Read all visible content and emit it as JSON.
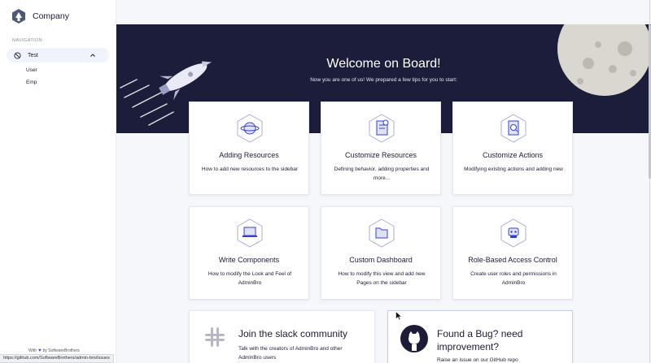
{
  "brand": {
    "name": "Company",
    "logo_icon": "company-logo-icon"
  },
  "sidebar": {
    "heading": "NAVIGATION",
    "group": {
      "label": "Test",
      "icon": "compass-icon",
      "expanded": true
    },
    "items": [
      {
        "label": "User"
      },
      {
        "label": "Emp"
      }
    ],
    "footer": {
      "with": "With",
      "heart": "♥",
      "by": "by SoftwareBrothers"
    }
  },
  "status_url": "https://github.com/SoftwareBrothers/admin-bro/issues",
  "hero": {
    "title": "Welcome on Board!",
    "subtitle": "Now you are one of us! We prepared a few tips for you to start:"
  },
  "cards": [
    {
      "title": "Adding Resources",
      "desc": "How to add new resources to the sidebar",
      "icon": "planet-icon"
    },
    {
      "title": "Customize Resources",
      "desc": "Defining behavior, adding properties and more...",
      "icon": "document-icon"
    },
    {
      "title": "Customize Actions",
      "desc": "Modifying existing actions and adding new",
      "icon": "file-search-icon"
    },
    {
      "title": "Write Components",
      "desc": "How to modify the Look and Feel of AdminBro",
      "icon": "laptop-icon"
    },
    {
      "title": "Custom Dashboard",
      "desc": "How to modify this view and add new Pages on the sidebar",
      "icon": "folder-icon"
    },
    {
      "title": "Role-Based Access Control",
      "desc": "Create user roles and permissions in AdminBro",
      "icon": "robot-icon"
    }
  ],
  "slack": {
    "title": "Join the slack community",
    "desc": "Talk with the creators of AdminBro and other AdminBro users",
    "icon": "slack-icon"
  },
  "bug": {
    "title": "Found a Bug? need improvement?",
    "desc": "Raise an issue on our GitHub repo",
    "icon": "github-icon"
  }
}
